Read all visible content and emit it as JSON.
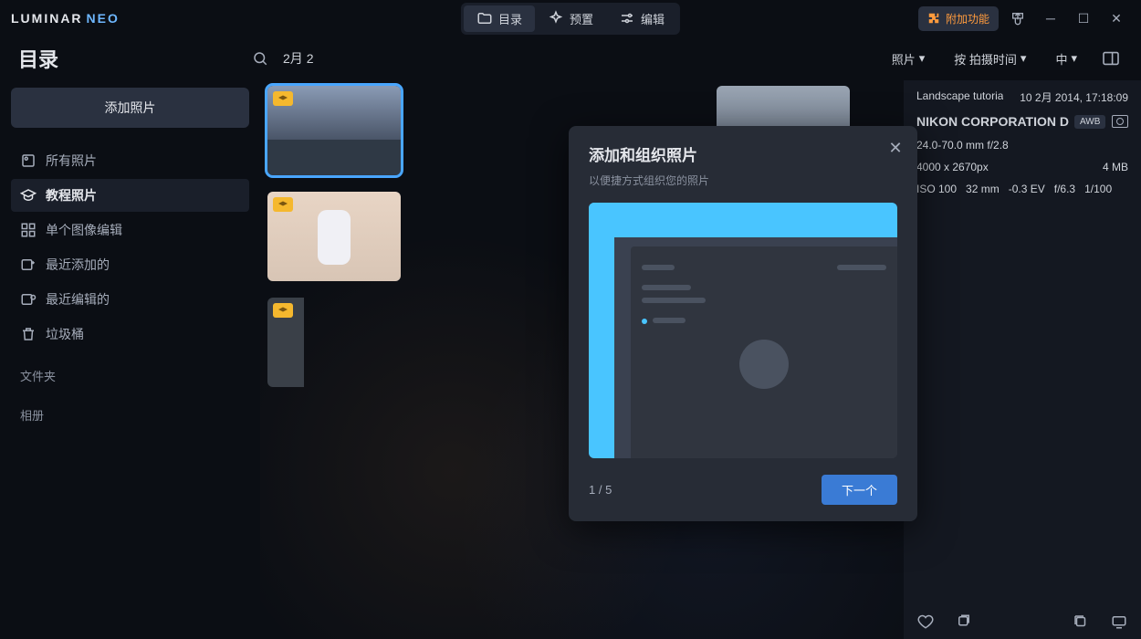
{
  "app_name_a": "LUMINAR",
  "app_name_b": "NEO",
  "top_tabs": {
    "catalog": "目录",
    "presets": "预置",
    "edit": "编辑"
  },
  "top_right": {
    "addon": "附加功能"
  },
  "page_title": "目录",
  "date_range": "2月 2",
  "view_controls": {
    "show_photos": "照片",
    "sort_label": "按 拍摄时间",
    "size_label": "中"
  },
  "sidebar": {
    "add_button": "添加照片",
    "items": [
      {
        "label": "所有照片"
      },
      {
        "label": "教程照片"
      },
      {
        "label": "单个图像编辑"
      },
      {
        "label": "最近添加的"
      },
      {
        "label": "最近编辑的"
      },
      {
        "label": "垃圾桶"
      }
    ],
    "section_folders": "文件夹",
    "section_albums": "相册"
  },
  "modal": {
    "title": "添加和组织照片",
    "subtitle": "以便捷方式组织您的照片",
    "step": "1 / 5",
    "next": "下一个"
  },
  "info": {
    "filename": "Landscape tutoria",
    "datetime": "10 2月 2014, 17:18:09",
    "camera": "NIKON CORPORATION D",
    "awb": "AWB",
    "lens": "24.0-70.0 mm f/2.8",
    "dims": "4000 x 2670px",
    "size": "4 MB",
    "iso": "ISO 100",
    "focal": "32 mm",
    "ev": "-0.3 EV",
    "aperture": "f/6.3",
    "shutter": "1/100"
  }
}
